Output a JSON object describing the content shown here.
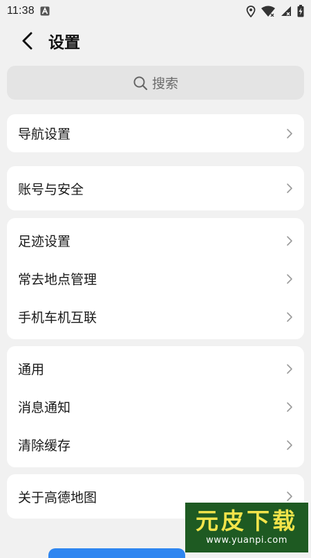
{
  "status_bar": {
    "time": "11:38",
    "icons": [
      "font-a-icon",
      "location-pin-icon",
      "wifi-icon",
      "cellular-signal-icon",
      "battery-charging-icon"
    ]
  },
  "header": {
    "back_icon": "chevron-left-icon",
    "title": "设置"
  },
  "search": {
    "icon": "search-icon",
    "placeholder": "搜索"
  },
  "groups": [
    {
      "items": [
        {
          "label": "导航设置"
        }
      ]
    },
    {
      "items": [
        {
          "label": "账号与安全"
        }
      ]
    },
    {
      "items": [
        {
          "label": "足迹设置"
        },
        {
          "label": "常去地点管理"
        },
        {
          "label": "手机车机互联"
        }
      ]
    },
    {
      "items": [
        {
          "label": "通用"
        },
        {
          "label": "消息通知"
        },
        {
          "label": "清除缓存"
        }
      ]
    },
    {
      "items": [
        {
          "label": "关于高德地图"
        }
      ]
    }
  ],
  "watermark": {
    "brand": "元皮下载",
    "url": "www.yuanpi.com"
  },
  "colors": {
    "background": "#f1f1f1",
    "card": "#ffffff",
    "search_bg": "#e4e4e4",
    "text": "#1a1a1a",
    "chevron": "#9a9a9a",
    "watermark_bg": "#1e5a22",
    "watermark_text": "#f3e44a"
  }
}
